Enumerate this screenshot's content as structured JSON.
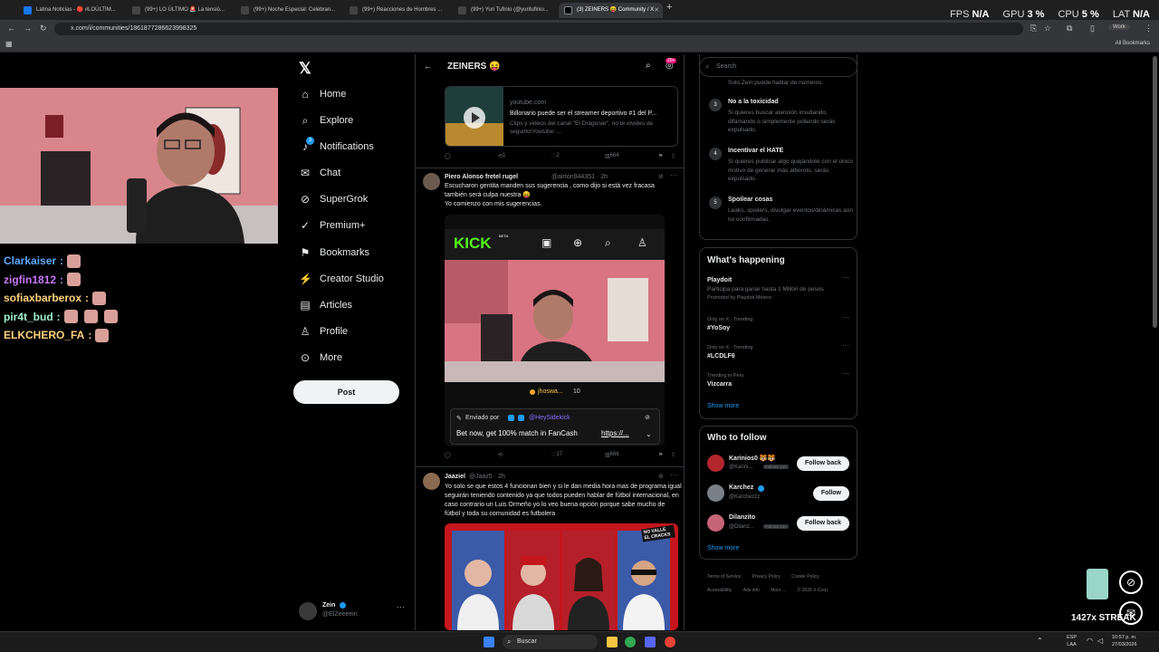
{
  "browser": {
    "tabs": [
      {
        "title": "Latina Noticias - 🔴 #LOÚLTIM..."
      },
      {
        "title": "(99+) LO ÚLTIMO 🚨 La tensió..."
      },
      {
        "title": "(99+) Noche Especial: Celebran..."
      },
      {
        "title": "(99+) Reacciones de Hombres ..."
      },
      {
        "title": "(99+) Yuri Tufinio (@yuritufinio..."
      },
      {
        "title": "(3) ZEINERS 😝 Community / X"
      }
    ],
    "url": "x.com/i/communities/1861877286623998325",
    "profile": "Work",
    "all_bookmarks": "All Bookmarks"
  },
  "hud": {
    "fps_label": "FPS",
    "fps": "N/A",
    "gpu_label": "GPU",
    "gpu": "3 %",
    "cpu_label": "CPU",
    "cpu": "5 %",
    "lat_label": "LAT",
    "lat": "N/A"
  },
  "stream_chat": [
    {
      "user": "Clarkaiser",
      "color": "#5aa9ff"
    },
    {
      "user": "zigfin1812",
      "color": "#c879ff"
    },
    {
      "user": "sofiaxbarberox",
      "color": "#ffd27a"
    },
    {
      "user": "pir4t_bud",
      "color": "#9ff0c8"
    },
    {
      "user": "ELKCHERO_FA",
      "color": "#ffd27a"
    }
  ],
  "nav": {
    "items": [
      {
        "label": "Home",
        "icon": "home-icon"
      },
      {
        "label": "Explore",
        "icon": "search-icon"
      },
      {
        "label": "Notifications",
        "icon": "bell-icon"
      },
      {
        "label": "Chat",
        "icon": "mail-icon"
      },
      {
        "label": "SuperGrok",
        "icon": "grok-icon"
      },
      {
        "label": "Premium+",
        "icon": "check-icon"
      },
      {
        "label": "Bookmarks",
        "icon": "bookmark-icon"
      },
      {
        "label": "Creator Studio",
        "icon": "studio-icon"
      },
      {
        "label": "Articles",
        "icon": "article-icon"
      },
      {
        "label": "Profile",
        "icon": "profile-icon"
      },
      {
        "label": "More",
        "icon": "more-icon"
      }
    ],
    "notif_badge": "3",
    "post_label": "Post",
    "account_name": "Zein",
    "account_handle": "@ElZeeeein"
  },
  "feed": {
    "title": "ZEINERS 😝",
    "header_badge": "20+",
    "link_card": {
      "domain": "youtube.com",
      "title": "Billonario puede ser el streamer deportivo #1 del P...",
      "desc": "Clips y videos del canal \"El Dragonar\", no te olvides de seguirlo!Youtube: ..."
    },
    "post0_stats": {
      "retweets": "1",
      "likes": "2",
      "views": "664"
    },
    "post1": {
      "name": "Piero Alonso fretel rugel",
      "handle": "@alrton944351 · 2h",
      "text1": "Escucharon gentita manden sus sugerencia , como dijo si está vez fracasa también será culpa nuestra 😝",
      "text2": "Yo comienzo con mis sugerencias.",
      "kick_logo": "KICK",
      "kick_beta": "BETA",
      "viewer": "jhoswa...",
      "viewer_count": "10",
      "sent_by": "Enviado por",
      "sent_by_user": "@HeySidekick",
      "promo": "Bet now, get 100% match in FanCash",
      "promo_link": "https://...",
      "likes": "17",
      "views": "666"
    },
    "post2": {
      "name": "Jaaziel",
      "handle": "@Jaaz5 · 2h",
      "text": "Yo solo se que estos 4 funcionan bien y si le dan media hora mas de programa igual seguirán teniendo contenido ya que todos pueden hablar de fútbol internacional, en caso contrario un Luis Ormeño yo lo veo buena opción porque sabe mucho de fútbol y toda su comunidad es futbolera",
      "image_tag": "NO VALLE EL CRACKS"
    }
  },
  "right": {
    "search_placeholder": "Search",
    "rules_intro": "Solo Zein puede hablar de números.",
    "rules": [
      {
        "num": "3",
        "title": "No a la toxicidad",
        "text": "Si quieres buscar atención insultando, difamando o simplemente jodiendo serás expulsado."
      },
      {
        "num": "4",
        "title": "Incentivar el HATE",
        "text": "Si quieres publicar algo quejándote con el único motivo de generar más alboroto, serás expulsado."
      },
      {
        "num": "5",
        "title": "Spoilear cosas",
        "text": "Leaks, spoilers, divulgar eventos/dinámicas aún no confirmadas."
      }
    ],
    "happening_title": "What's happening",
    "trends": [
      {
        "meta": "",
        "name": "Playdoit",
        "sub": "Participa para ganar hasta 1 Millón de pesos",
        "promo": "Promoted by Playdoit México"
      },
      {
        "meta": "Only on X · Trending",
        "name": "#YoSoy",
        "sub": "",
        "promo": ""
      },
      {
        "meta": "Only on X · Trending",
        "name": "#LCDLF6",
        "sub": "",
        "promo": ""
      },
      {
        "meta": "Trending in Peru",
        "name": "Vizcarra",
        "sub": "",
        "promo": ""
      }
    ],
    "show_more": "Show more",
    "wtf_title": "Who to follow",
    "wtf": [
      {
        "name": "Karinios0 🐯🐯",
        "handle": "@Karini...",
        "follows_you": "Follows you",
        "button": "Follow back"
      },
      {
        "name": "Karchez",
        "handle": "@Karchezzz",
        "follows_you": "",
        "button": "Follow"
      },
      {
        "name": "Dilanzito",
        "handle": "@Dilanz...",
        "follows_you": "Follows you",
        "button": "Follow back"
      }
    ],
    "footer": [
      "Terms of Service",
      "Privacy Policy",
      "Cookie Policy",
      "Accessibility",
      "Ads info",
      "More ...",
      "© 2026 X Corp."
    ]
  },
  "overlay": {
    "streak": "1427x STREAK"
  },
  "taskbar": {
    "search": "Buscar",
    "lang1": "ESP",
    "lang2": "LAA",
    "time": "10:57 p. m.",
    "date": "27/03/2026"
  },
  "colors": {
    "accent": "#1d9bf0",
    "kick": "#53fc18",
    "bg": "#000000"
  }
}
